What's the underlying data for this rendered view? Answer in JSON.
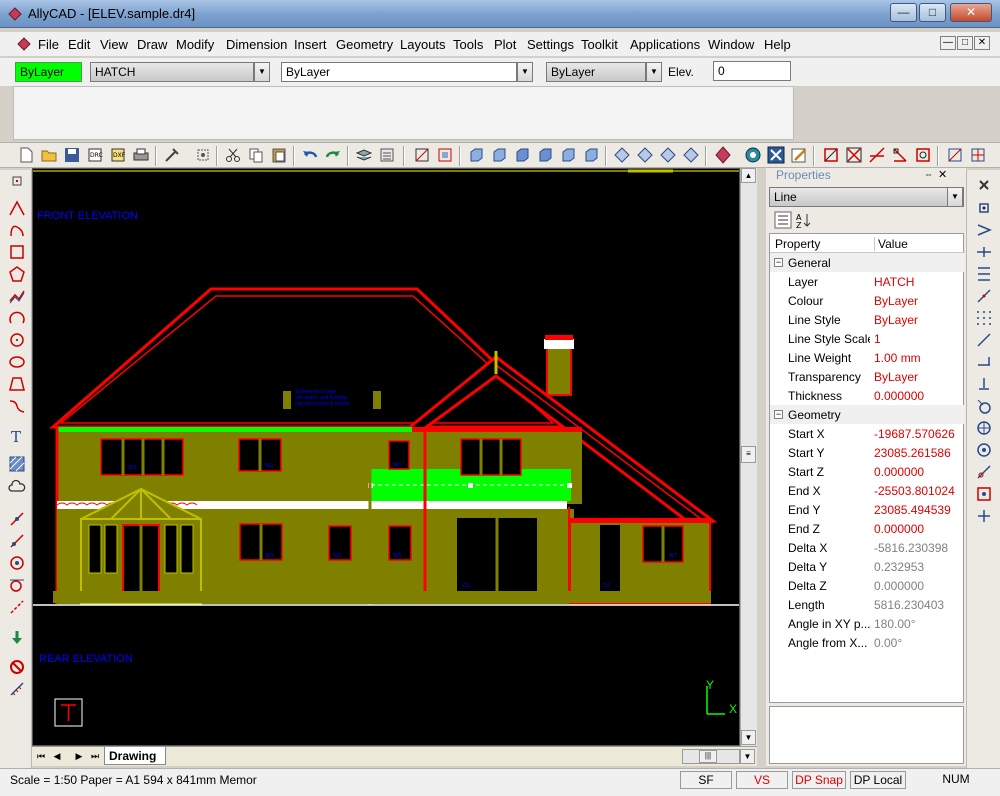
{
  "window": {
    "title": "AllyCAD - [ELEV.sample.dr4]",
    "min_glyph": "—",
    "max_glyph": "□",
    "close_glyph": "✕"
  },
  "menu": [
    "File",
    "Edit",
    "View",
    "Draw",
    "Modify",
    "Dimension",
    "Insert",
    "Geometry",
    "Layouts",
    "Tools",
    "Plot",
    "Settings",
    "Toolkit",
    "Applications",
    "Window",
    "Help"
  ],
  "props_row": {
    "color_value": "ByLayer",
    "layer_value": "HATCH",
    "linestyle_value": "ByLayer",
    "lineweight_value": "ByLayer",
    "elev_label": "Elev.",
    "elev_value": "0"
  },
  "drawing": {
    "front_label": "FRONT ELEVATION",
    "rear_label": "REAR ELEVATION",
    "note_lines": [
      "110mm dia or sige",
      "sim state's and flashing",
      "cap pot section & terrillet"
    ],
    "axis_y": "Y",
    "axis_x": "X",
    "sheet_tab": "Drawing"
  },
  "properties": {
    "title": "Properties",
    "selected": "Line",
    "col_property": "Property",
    "col_value": "Value",
    "sections": [
      {
        "name": "General",
        "rows": [
          {
            "k": "Layer",
            "v": "HATCH",
            "style": "red"
          },
          {
            "k": "Colour",
            "v": "ByLayer",
            "style": "red"
          },
          {
            "k": "Line Style",
            "v": "ByLayer",
            "style": "red"
          },
          {
            "k": "Line Style Scale",
            "v": "1",
            "style": "red"
          },
          {
            "k": "Line Weight",
            "v": " 1.00 mm",
            "style": "red"
          },
          {
            "k": "Transparency",
            "v": "ByLayer",
            "style": "red"
          },
          {
            "k": "Thickness",
            "v": "0.000000",
            "style": "red"
          }
        ]
      },
      {
        "name": "Geometry",
        "rows": [
          {
            "k": "Start X",
            "v": "-19687.570626",
            "style": "red"
          },
          {
            "k": "Start Y",
            "v": "23085.261586",
            "style": "red"
          },
          {
            "k": "Start Z",
            "v": "0.000000",
            "style": "red"
          },
          {
            "k": "End X",
            "v": "-25503.801024",
            "style": "red"
          },
          {
            "k": "End Y",
            "v": "23085.494539",
            "style": "red"
          },
          {
            "k": "End Z",
            "v": "0.000000",
            "style": "red"
          },
          {
            "k": "Delta X",
            "v": "-5816.230398",
            "style": "grayv"
          },
          {
            "k": "Delta Y",
            "v": "0.232953",
            "style": "grayv"
          },
          {
            "k": "Delta Z",
            "v": "0.000000",
            "style": "grayv"
          },
          {
            "k": "Length",
            "v": "5816.230403",
            "style": "grayv"
          },
          {
            "k": "Angle in XY p...",
            "v": "180.00°",
            "style": "grayv"
          },
          {
            "k": "Angle from X...",
            "v": "0.00°",
            "style": "grayv"
          }
        ]
      }
    ]
  },
  "status": {
    "text": "Scale = 1:50  Paper = A1 594 x 841mm  Memor",
    "sf": "SF",
    "vs": "VS",
    "dpsnap": "DP Snap",
    "dplocal": "DP Local",
    "num": "NUM"
  },
  "colors": {
    "bylayer_green": "#00ff00",
    "house_fill": "#808000",
    "outline_red": "#ff0000",
    "label_blue": "#0000ff"
  }
}
